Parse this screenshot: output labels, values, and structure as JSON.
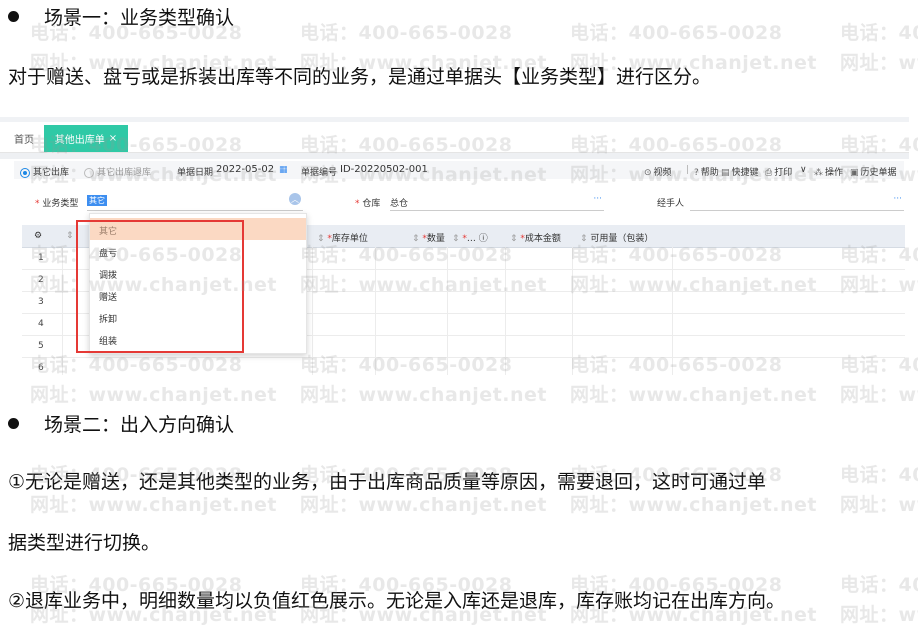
{
  "section1": {
    "title": "场景一：业务类型确认"
  },
  "para1": "对于赠送、盘亏或是拆装出库等不同的业务，是通过单据头【业务类型】进行区分。",
  "screenshot": {
    "tabs": {
      "home": "首页",
      "active": "其他出库单",
      "close": "×"
    },
    "radios": {
      "out": "其它出库",
      "return": "其它出库退库"
    },
    "date_label": "单据日期",
    "date_value": "2022-05-02",
    "code_label": "单据编号",
    "code_value": "ID-20220502-001",
    "actions": {
      "video": "视频",
      "help": "帮助",
      "shortcut": "快捷键",
      "print": "打印",
      "more": "∨",
      "ops": "操作",
      "history": "历史单据"
    },
    "form": {
      "biz_type_label": "业务类型",
      "biz_type_value": "其它",
      "warehouse_label": "仓库",
      "warehouse_value": "总仓",
      "handler_label": "经手人",
      "dots": "···"
    },
    "grid_headers": [
      "库存单位",
      "数量",
      "…",
      "成本金额",
      "可用量（包装）"
    ],
    "row_numbers": [
      "1",
      "2",
      "3",
      "4",
      "5",
      "6"
    ],
    "dropdown_options": [
      "其它",
      "盘亏",
      "调拨",
      "赠送",
      "拆卸",
      "组装"
    ]
  },
  "section2": {
    "title": "场景二：出入方向确认"
  },
  "para2a": "①无论是赠送，还是其他类型的业务，由于出库商品质量等原因，需要退回，这时可通过单",
  "para2b": "据类型进行切换。",
  "para3": "②退库业务中，明细数量均以负值红色展示。无论是入库还是退库，库存账均记在出库方向。",
  "watermark": {
    "phone": "电话：400-665-0028",
    "site": "网址：www.chanjet.net"
  },
  "colors": {
    "tab_active": "#2fc9a6",
    "highlight_box": "#e53935",
    "selected_option": "#fbd9c3"
  }
}
